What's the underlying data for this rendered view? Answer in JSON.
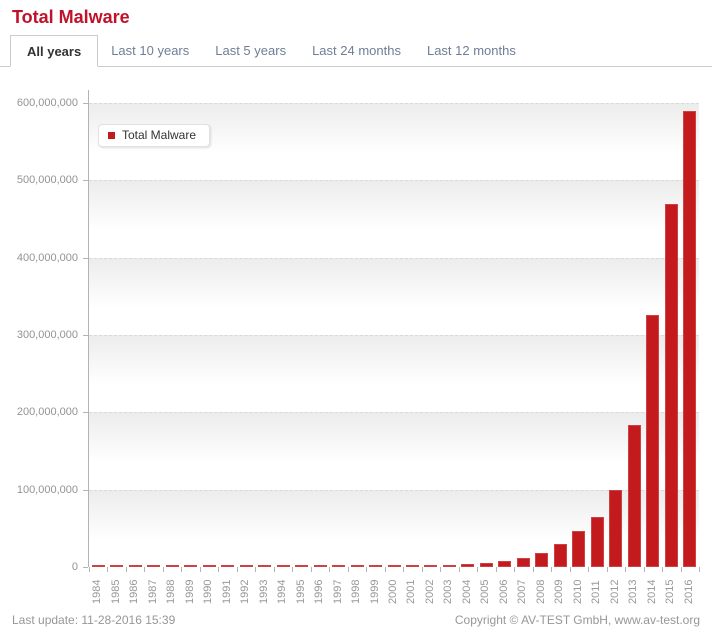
{
  "title": "Total Malware",
  "tabs": [
    {
      "label": "All years",
      "active": true
    },
    {
      "label": "Last 10 years",
      "active": false
    },
    {
      "label": "Last 5 years",
      "active": false
    },
    {
      "label": "Last 24 months",
      "active": false
    },
    {
      "label": "Last 12 months",
      "active": false
    }
  ],
  "legend": {
    "label": "Total Malware",
    "marker_color": "#c21a1d"
  },
  "footer": {
    "last_update": "Last update: 11-28-2016 15:39",
    "copyright": "Copyright © AV-TEST GmbH, www.av-test.org"
  },
  "colors": {
    "title_red": "#c1122b",
    "bar_red": "#c21a1d",
    "tab_inactive_text": "#6f7e96",
    "active_tab_text": "#333333",
    "tab_border": "#cccccc",
    "grid_line": "#d9d9d9",
    "axis_line": "#b3b3b3",
    "band_shade_top": "#ececec",
    "axis_text": "#999999",
    "footer_text": "#979797"
  },
  "chart_data": {
    "type": "bar",
    "title": "Total Malware",
    "legend_position": "top-left",
    "grid": "horizontal dashed gridlines with shaded band fading below each line",
    "xlabel": "",
    "ylabel": "",
    "ylim": [
      0,
      600000000
    ],
    "ytick_interval": 100000000,
    "ytick_labels": [
      "0",
      "100,000,000",
      "200,000,000",
      "300,000,000",
      "400,000,000",
      "500,000,000",
      "600,000,000"
    ],
    "categories": [
      1984,
      1985,
      1986,
      1987,
      1988,
      1989,
      1990,
      1991,
      1992,
      1993,
      1994,
      1995,
      1996,
      1997,
      1998,
      1999,
      2000,
      2001,
      2002,
      2003,
      2004,
      2005,
      2006,
      2007,
      2008,
      2009,
      2010,
      2011,
      2012,
      2013,
      2014,
      2015,
      2016
    ],
    "values": [
      0,
      600,
      2200,
      8200,
      21000,
      45000,
      74000,
      114000,
      179000,
      247000,
      318000,
      399000,
      499000,
      630000,
      787000,
      983000,
      1250000,
      1600000,
      2100000,
      2700000,
      3500000,
      5100000,
      7400000,
      11000000,
      18000000,
      30000000,
      47000000,
      65000000,
      100000000,
      183000000,
      326000000,
      470000000,
      590000000
    ],
    "series": [
      {
        "name": "Total Malware",
        "color": "#c21a1d"
      }
    ]
  }
}
